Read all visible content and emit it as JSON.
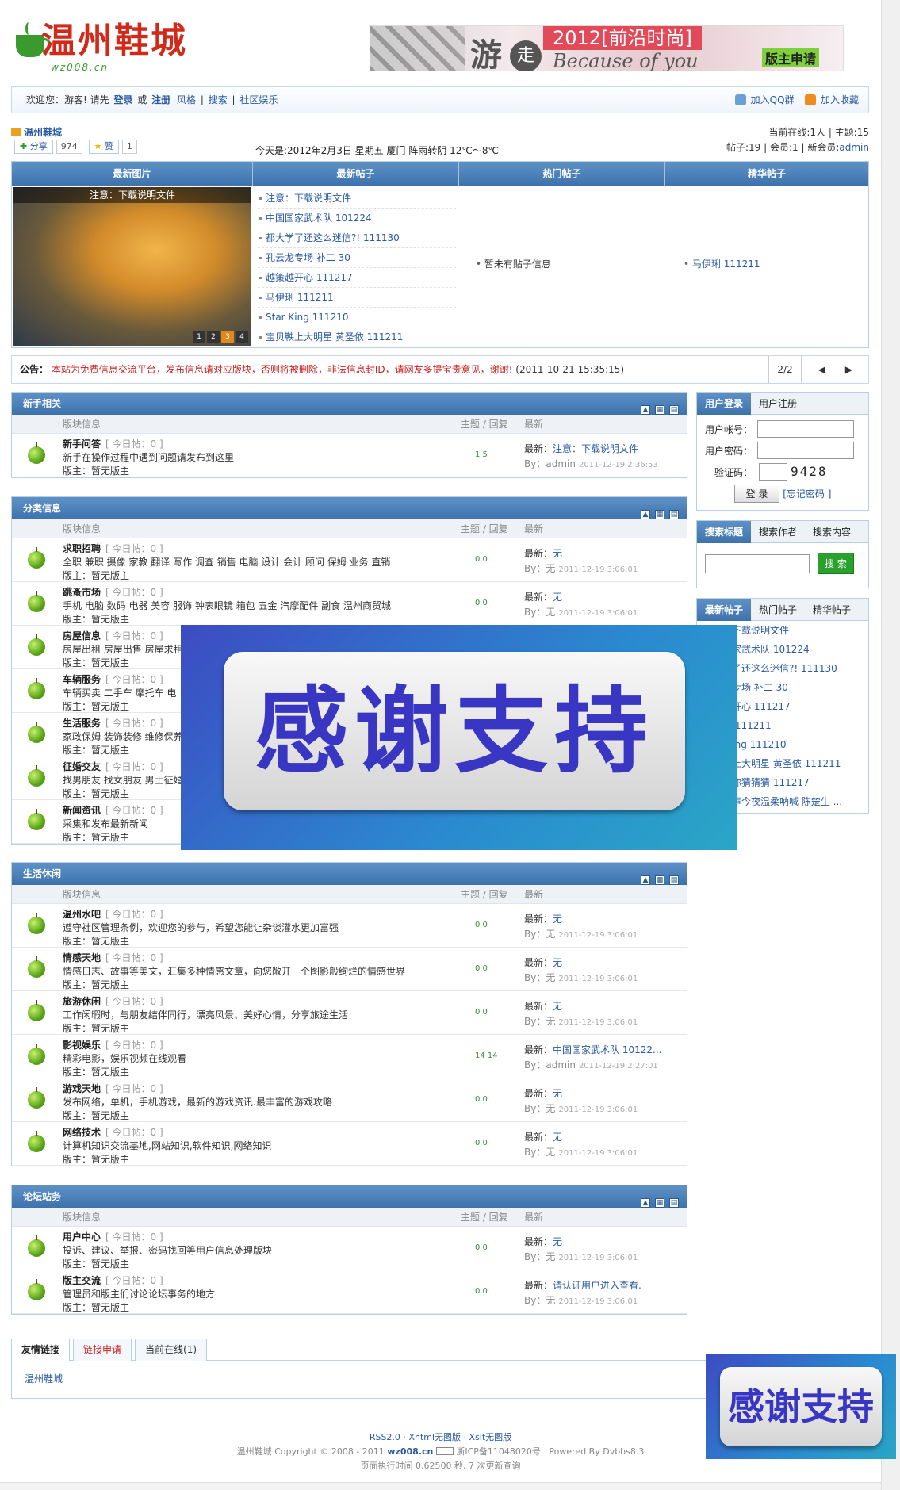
{
  "header": {
    "logo_text": "温州鞋城",
    "logo_sub": "wz008.cn",
    "banner": {
      "t1": "游",
      "t2": "走",
      "t3": "2012[前沿时尚]",
      "t4": "Because of you",
      "t5": "版主申请"
    }
  },
  "topbar": {
    "welcome": "欢迎您：游客!",
    "please": "请先",
    "login": "登录",
    "or": "或",
    "register": "注册",
    "style": "风格",
    "search": "搜索",
    "community": "社区娱乐",
    "add_qq": "加入QQ群",
    "add_fav": "加入收藏"
  },
  "info": {
    "site": "温州鞋城",
    "share": "分享",
    "share_count": "974",
    "like": "赞",
    "like_count": "1",
    "date": "今天是:2012年2月3日 星期五 厦门 阵雨转阴 12℃～8℃",
    "stats_line1": "当前在线:1人 | 主题:15",
    "stats_line2": "帖子:19 | 会员:1 | 新会员:",
    "newest_member": "admin"
  },
  "latest": {
    "headers": [
      "最新图片",
      "最新帖子",
      "热门帖子",
      "精华帖子"
    ],
    "photo_caption": "注意：下载说明文件",
    "pages": [
      "1",
      "2",
      "3",
      "4"
    ],
    "new_posts": [
      "注意：下载说明文件",
      "中国国家武术队 101224",
      "都大学了还这么迷信?! 111130",
      "孔云龙专场 补二 30",
      "越策越开心 111217",
      "马伊琍 111211",
      "Star King 111210",
      "宝贝鞅上大明星 黄圣依 111211"
    ],
    "hot": "暂未有贴子信息",
    "elite": "马伊琍 111211"
  },
  "notice": {
    "label": "公告：",
    "text": "本站为免费信息交流平台，发布信息请对应版块，否则将被删除，非法信息封ID，请网友多提宝贵意见，谢谢!",
    "time": "(2011-10-21 15:35:15)",
    "page": "2/2",
    "prev": "◀",
    "next": "▶"
  },
  "cols": {
    "forum": "版块信息",
    "counts": "主题 / 回复",
    "latest": "最新"
  },
  "today": "[ 今日帖：0 ]",
  "moderator": "版主：暂无版主",
  "latest_prefix": "最新：",
  "by_prefix": "By：",
  "sections": [
    {
      "title": "新手相关",
      "rows": [
        {
          "name": "新手问答",
          "desc": "新手在操作过程中遇到问题请发布到这里",
          "counts": "1  5",
          "latest": "注意：下载说明文件",
          "by": "admin",
          "time": "2011-12-19 2:36:53"
        }
      ]
    },
    {
      "title": "分类信息",
      "rows": [
        {
          "name": "求职招聘",
          "desc": "全职 兼职 摄像 家教 翻译 写作 调查 销售 电脑 设计 会计 顾问 保姆 业务 直销",
          "counts": "0  0",
          "latest": "无",
          "by": "无",
          "time": "2011-12-19 3:06:01"
        },
        {
          "name": "跳蚤市场",
          "desc": "手机 电脑 数码 电器 美容 服饰 钟表眼镜 箱包 五金 汽摩配件 副食 温州商贸城",
          "counts": "0  0",
          "latest": "无",
          "by": "无",
          "time": "2011-12-19 3:06:01"
        },
        {
          "name": "房屋信息",
          "desc": "房屋出租 房屋出售 房屋求租",
          "counts": "",
          "latest": "",
          "by": "",
          "time": ""
        },
        {
          "name": "车辆服务",
          "desc": "车辆买卖 二手车 摩托车 电",
          "counts": "",
          "latest": "",
          "by": "",
          "time": ""
        },
        {
          "name": "生活服务",
          "desc": "家政保姆 装饰装修 维修保养",
          "counts": "",
          "latest": "",
          "by": "",
          "time": ""
        },
        {
          "name": "征婚交友",
          "desc": "找男朋友 找女朋友 男士征婚",
          "counts": "",
          "latest": "",
          "by": "",
          "time": ""
        },
        {
          "name": "新闻资讯",
          "desc": "采集和发布最新新闻",
          "counts": "",
          "latest": "",
          "by": "",
          "time": ""
        }
      ]
    },
    {
      "title": "生活休闲",
      "rows": [
        {
          "name": "温州水吧",
          "desc": "遵守社区管理条例，欢迎您的参与，希望您能让杂谈灌水更加富强",
          "counts": "0  0",
          "latest": "无",
          "by": "无",
          "time": "2011-12-19 3:06:01"
        },
        {
          "name": "情感天地",
          "desc": "情感日志、故事等美文，汇集多种情感文章，向您敞开一个图影般绚烂的情感世界",
          "counts": "0  0",
          "latest": "无",
          "by": "无",
          "time": "2011-12-19 3:06:01"
        },
        {
          "name": "旅游休闲",
          "desc": "工作闲暇时，与朋友结伴同行，漂亮风景、美好心情，分享旅途生活",
          "counts": "0  0",
          "latest": "无",
          "by": "无",
          "time": "2011-12-19 3:06:01"
        },
        {
          "name": "影视娱乐",
          "desc": "精彩电影，娱乐视频在线观看",
          "counts": "14  14",
          "latest": "中国国家武术队 10122...",
          "by": "admin",
          "time": "2011-12-19 2:27:01"
        },
        {
          "name": "游戏天地",
          "desc": "发布网络，单机，手机游戏，最新的游戏资讯.最丰富的游戏攻略",
          "counts": "0  0",
          "latest": "无",
          "by": "无",
          "time": "2011-12-19 3:06:01"
        },
        {
          "name": "网络技术",
          "desc": "计算机知识交流基地,网站知识,软件知识,网络知识",
          "counts": "0  0",
          "latest": "无",
          "by": "无",
          "time": "2011-12-19 3:06:01"
        }
      ]
    },
    {
      "title": "论坛站务",
      "rows": [
        {
          "name": "用户中心",
          "desc": "投诉、建议、举报、密码找回等用户信息处理版块",
          "counts": "0  0",
          "latest": "无",
          "by": "无",
          "time": "2011-12-19 3:06:01"
        },
        {
          "name": "版主交流",
          "desc": "管理员和版主们讨论论坛事务的地方",
          "counts": "0  0",
          "latest": "请认证用户进入查看.",
          "by": "无",
          "time": "2011-12-19 3:06:01"
        }
      ]
    }
  ],
  "sidebar": {
    "login_tabs": [
      "用户登录",
      "用户注册"
    ],
    "account_label": "用户帐号：",
    "password_label": "用户密码：",
    "captcha_label": "验证码：",
    "captcha_code": "9428",
    "login_button": "登 录",
    "forgot": "[忘记密码 ]",
    "search_tabs": [
      "搜索标题",
      "搜索作者",
      "搜索内容"
    ],
    "search_button": "搜 索",
    "post_tabs": [
      "最新帖子",
      "热门帖子",
      "精华帖子"
    ],
    "posts": [
      "注意：下载说明文件",
      "中国国家武术队 101224",
      "都大学了还这么迷信?! 111130",
      "孔云龙专场 补二 30",
      "越策越开心 111217",
      "马伊琍 111211",
      "Star King 111210",
      "宝贝鞅上大明星 黄圣依 111211",
      "猜你猜你猜猜猜 111217",
      "快乐男声今夜温柔呐喊 陈楚生 ..."
    ]
  },
  "overlay": {
    "text": "感谢支持"
  },
  "links": {
    "tabs": [
      "友情链接",
      "链接申请",
      "当前在线(1)"
    ],
    "items": [
      "温州鞋城"
    ]
  },
  "footer": {
    "line1": [
      "RSS2.0",
      "Xhtml无图版",
      "Xslt无图版"
    ],
    "site": "温州鞋城",
    "copyright": "Copyright © 2008 - 2011",
    "domain": "wz008.cn",
    "icp": "浙ICP备11048020号",
    "powered": "Powered By Dvbbs8.3",
    "exec": "页面执行时间 0.62500 秒, 7 次更新查询"
  },
  "colors": {
    "header_blue": "#3e72ad",
    "link": "#2a5aa0",
    "notice_red": "#c81d1d",
    "overlay_text": "#3a36c4"
  }
}
